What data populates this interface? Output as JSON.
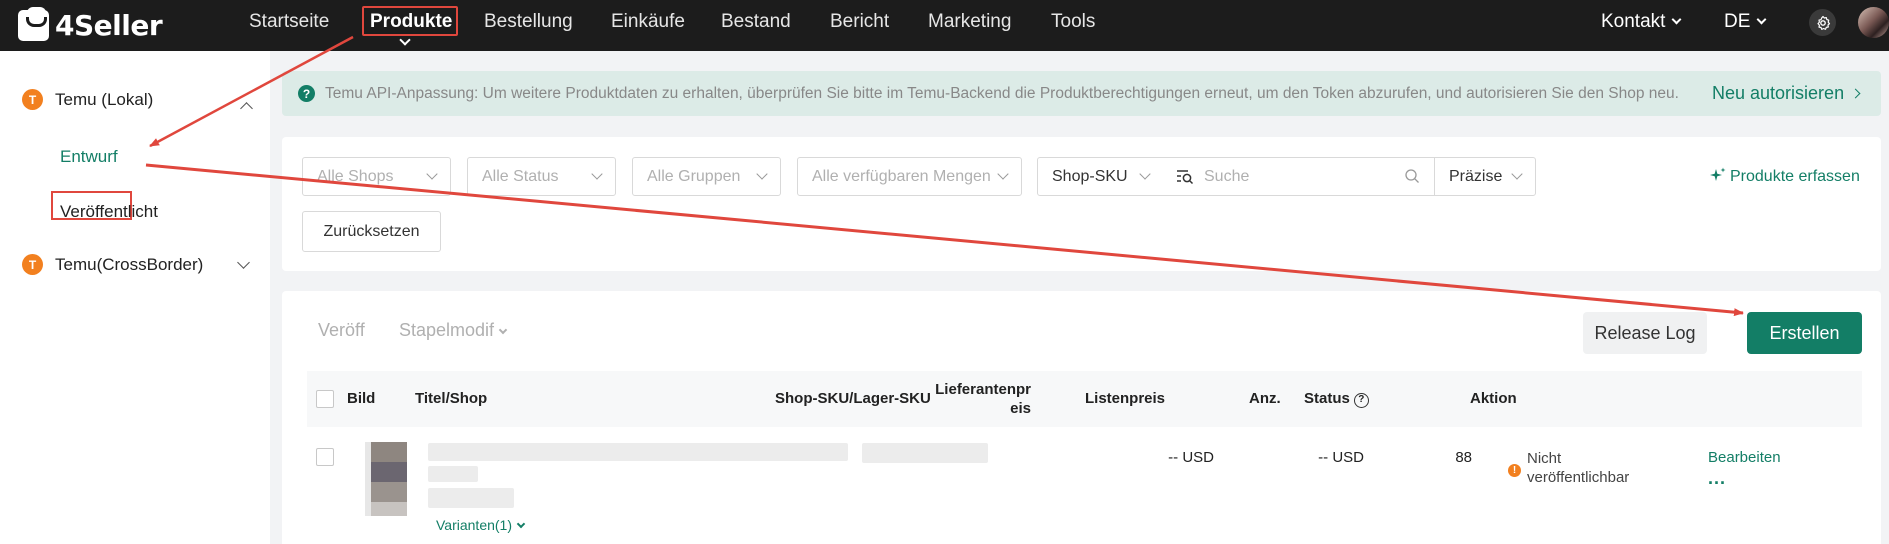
{
  "app": {
    "name": "4Seller"
  },
  "topnav": {
    "items": [
      "Startseite",
      "Produkte",
      "Bestellung",
      "Einkäufe",
      "Bestand",
      "Bericht",
      "Marketing",
      "Tools"
    ],
    "active": "Produkte",
    "contact": "Kontakt",
    "language": "DE"
  },
  "sidebar": {
    "groups": [
      {
        "badge": "T",
        "label": "Temu (Lokal)",
        "expanded": true,
        "items": [
          "Entwurf",
          "Veröffentlicht"
        ],
        "active": "Entwurf"
      },
      {
        "badge": "T",
        "label": "Temu(CrossBorder)",
        "expanded": false
      }
    ]
  },
  "notice": {
    "icon": "?",
    "text": "Temu API-Anpassung: Um weitere Produktdaten zu erhalten, überprüfen Sie bitte im Temu-Backend die Produktberechtigungen erneut, um den Token abzurufen, und autorisieren Sie den Shop neu.",
    "link": "Neu autorisieren"
  },
  "filters": {
    "shops": "Alle Shops",
    "status": "Alle Status",
    "groups": "Alle Gruppen",
    "quantities": "Alle verfügbaren Mengen",
    "search_field": "Shop-SKU",
    "search_placeholder": "Suche",
    "match_mode": "Präzise",
    "capture": "Produkte erfassen",
    "reset": "Zurücksetzen"
  },
  "toolbar": {
    "publish": "Veröff",
    "batch_modify": "Stapelmodif",
    "release_log": "Release Log",
    "create": "Erstellen"
  },
  "table": {
    "columns": [
      "Bild",
      "Titel/Shop",
      "Shop-SKU/Lager-SKU",
      "Lieferantenpreis",
      "Listenpreis",
      "Anz.",
      "Status",
      "Aktion"
    ],
    "rows": [
      {
        "supplier_price": "-- USD",
        "list_price": "-- USD",
        "quantity": "88",
        "status_line1": "Nicht",
        "status_line2": "veröffentlichbar",
        "action": "Bearbeiten",
        "more": "...",
        "variants": "Varianten(1)"
      }
    ]
  },
  "colors": {
    "brand": "#137e66",
    "topbar": "#1c1c1c",
    "annotation": "#e0473d",
    "badge": "#f2801f"
  }
}
